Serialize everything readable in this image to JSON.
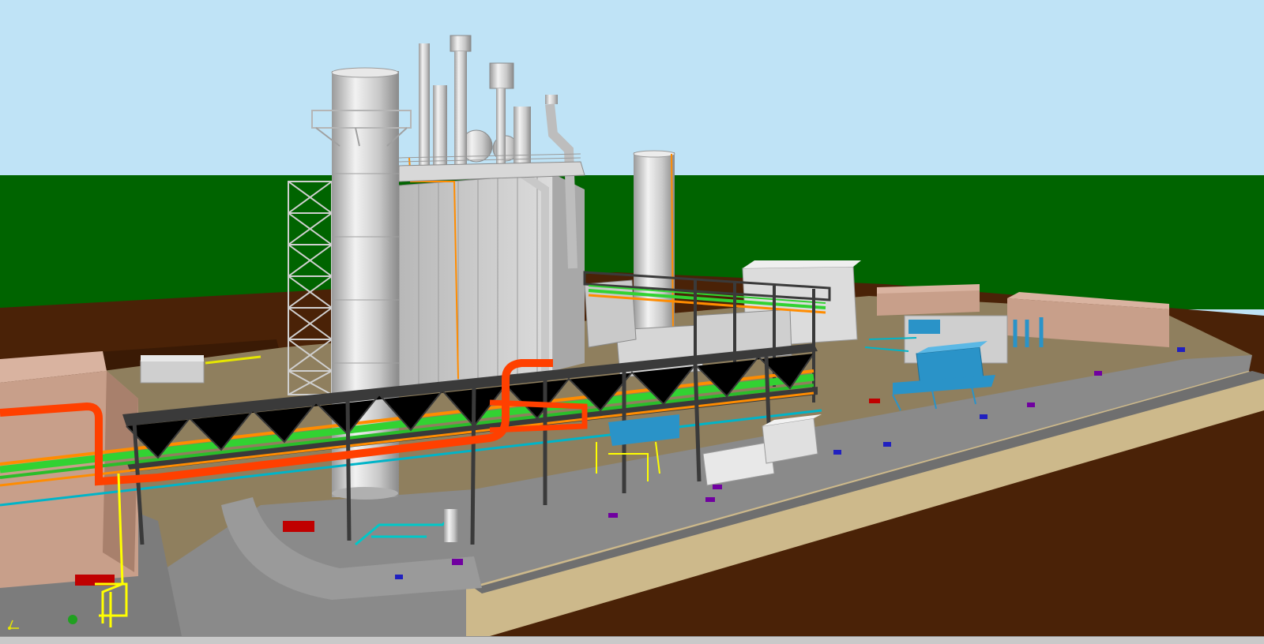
{
  "viewport": {
    "colors": {
      "sky": "#bfe3f6",
      "grass": "#006400",
      "earth": "#4a2207",
      "pad": "#8f7f5e",
      "road": "#8a8a8a",
      "curb": "#cdb98b",
      "steel": "#d6d6d6",
      "truss": "#3a3a3a",
      "pipe_red": "#ff4000",
      "pipe_green": "#32d232",
      "pipe_orange": "#ff8c00",
      "pipe_cyan": "#00b4c8",
      "pipe_yellow": "#ffff00",
      "equipment_blue": "#2a93c8",
      "building_pink": "#c89f8a",
      "marker_blue": "#2020c0",
      "marker_red": "#c00000",
      "marker_purple": "#7000a0"
    },
    "icons": [
      "axis-triad-icon"
    ]
  },
  "status_bar": {}
}
